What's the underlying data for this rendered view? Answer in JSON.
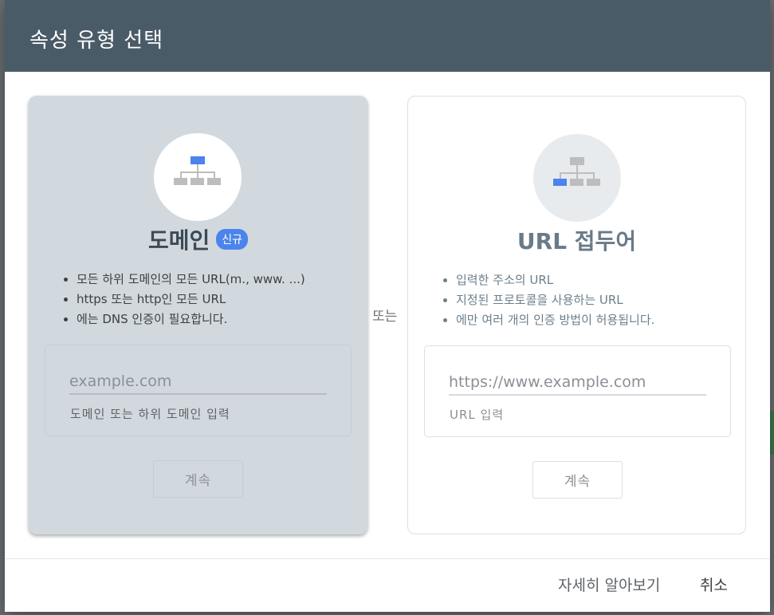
{
  "dialog": {
    "title": "속성 유형 선택",
    "or_label": "또는",
    "footer": {
      "learn_more": "자세히 알아보기",
      "cancel": "취소"
    }
  },
  "domain_card": {
    "title": "도메인",
    "badge": "신규",
    "icon": "sitemap-icon",
    "bullets": [
      "모든 하위 도메인의 모든 URL(m., www. ...)",
      "https 또는 http인 모든 URL",
      "에는 DNS 인증이 필요합니다."
    ],
    "input_placeholder": "example.com",
    "input_hint": "도메인 또는 하위 도메인 입력",
    "continue_label": "계속"
  },
  "url_card": {
    "title": "URL 접두어",
    "icon": "sitemap-icon",
    "bullets": [
      "입력한 주소의 URL",
      "지정된 프로토콜을 사용하는 URL",
      "에만 여러 개의 인증 방법이 허용됩니다."
    ],
    "input_placeholder": "https://www.example.com",
    "input_hint": "URL 입력",
    "continue_label": "계속"
  },
  "colors": {
    "header": "#4a5b68",
    "domain_card_bg": "#d1d9de",
    "accent_blue": "#4a84ec",
    "icon_gray": "#bdbdbd"
  }
}
